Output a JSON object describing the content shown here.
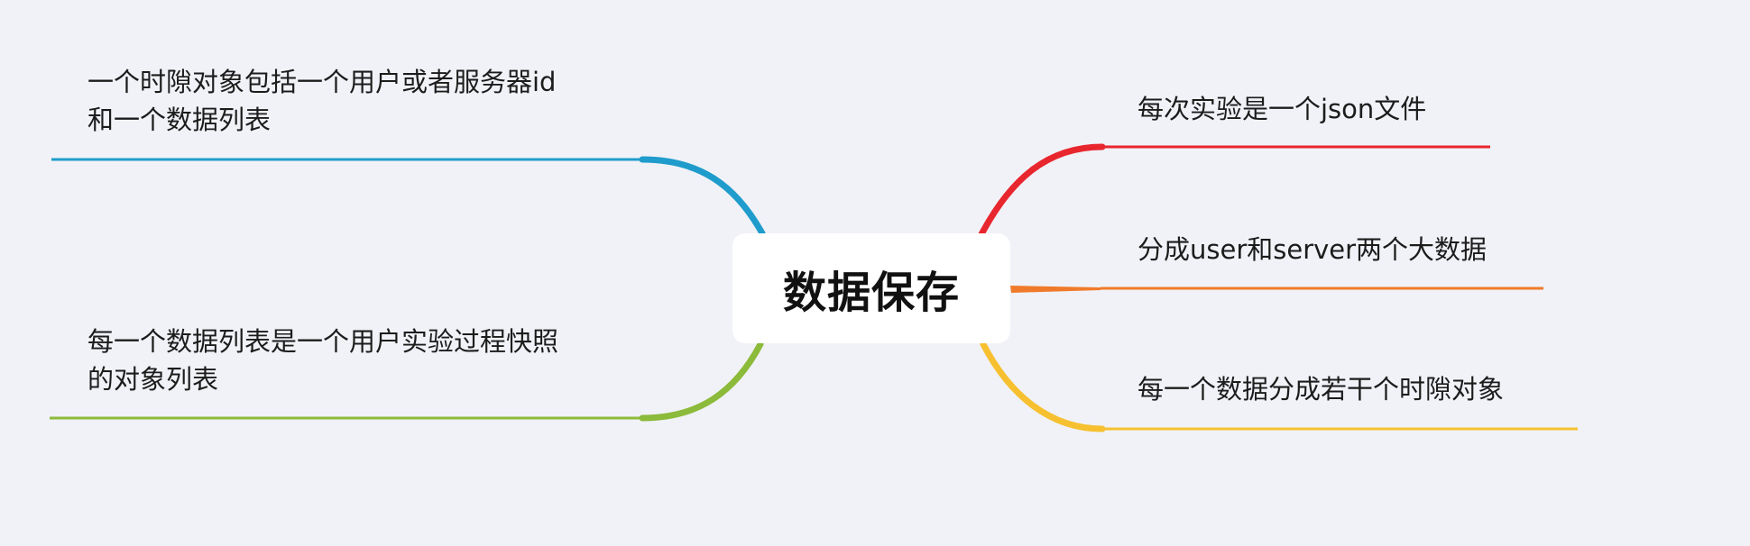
{
  "mindmap": {
    "central_topic": "数据保存",
    "branches": [
      {
        "id": "right-1",
        "side": "right",
        "lines": [
          "每次实验是一个json文件"
        ],
        "color": "#e8262e"
      },
      {
        "id": "right-2",
        "side": "right",
        "lines": [
          "分成user和server两个大数据"
        ],
        "color": "#f07a2b"
      },
      {
        "id": "right-3",
        "side": "right",
        "lines": [
          "每一个数据分成若干个时隙对象"
        ],
        "color": "#f6c030"
      },
      {
        "id": "left-1",
        "side": "left",
        "lines": [
          "一个时隙对象包括一个用户或者服务器id",
          "和一个数据列表"
        ],
        "color": "#1f9ccc"
      },
      {
        "id": "left-2",
        "side": "left",
        "lines": [
          "每一个数据列表是一个用户实验过程快照",
          "的对象列表"
        ],
        "color": "#8cba3a"
      }
    ]
  }
}
